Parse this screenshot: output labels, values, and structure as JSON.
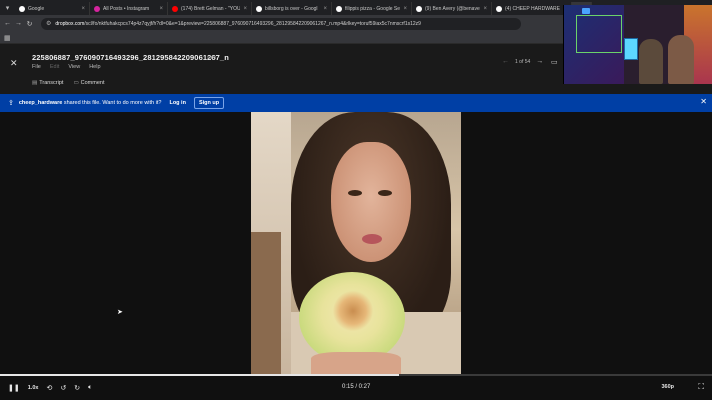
{
  "browser": {
    "tabs": [
      {
        "label": "Google",
        "favicon_color": "#ffffff",
        "active": false
      },
      {
        "label": "All Posts • Instagram",
        "favicon_color": "#d6249f",
        "active": false
      },
      {
        "label": "(174) Brett Gelman - \"YOU",
        "favicon_color": "#ff0000",
        "active": false
      },
      {
        "label": "billsborg is over - Googl",
        "favicon_color": "#ffffff",
        "active": false
      },
      {
        "label": "filippis pizza - Google Se",
        "favicon_color": "#ffffff",
        "active": false
      },
      {
        "label": "(9) Ben Avery (@benave",
        "favicon_color": "#ffffff",
        "active": false
      },
      {
        "label": "(4) CHEEP HARDWARE / X",
        "favicon_color": "#ffffff",
        "active": false
      },
      {
        "label": "",
        "favicon_color": "#0061fe",
        "active": true
      }
    ],
    "url_host": "dropbox.com",
    "url_path": "/scl/fo/nktfuhakcpcs74p4z7qyjf/h?dl=0&e=1&preview=225806887_976090716493296_281295842209061267_n.mp4&rlkey=toruf59iax5c7nmscrf1s12z9"
  },
  "dropbox": {
    "filename": "225806887_976090716493296_281295842209061267_n",
    "extension": "MP4",
    "menu": [
      "File",
      "Edit",
      "View",
      "Help"
    ],
    "subtabs": [
      "Transcript",
      "Comment"
    ],
    "pager_text": "1 of 54"
  },
  "banner": {
    "user": "cheep_hardware",
    "message": " shared this file. Want to do more with it?",
    "login_label": "Log in",
    "signup_label": "Sign up"
  },
  "player": {
    "speed": "1.0x",
    "current_time": "0:15",
    "duration": "0:27",
    "time_text": "0:15 / 0:27",
    "quality": "360p",
    "progress_fraction": 0.56
  },
  "colors": {
    "banner_bg": "#003fa5",
    "app_bg": "#101010"
  }
}
